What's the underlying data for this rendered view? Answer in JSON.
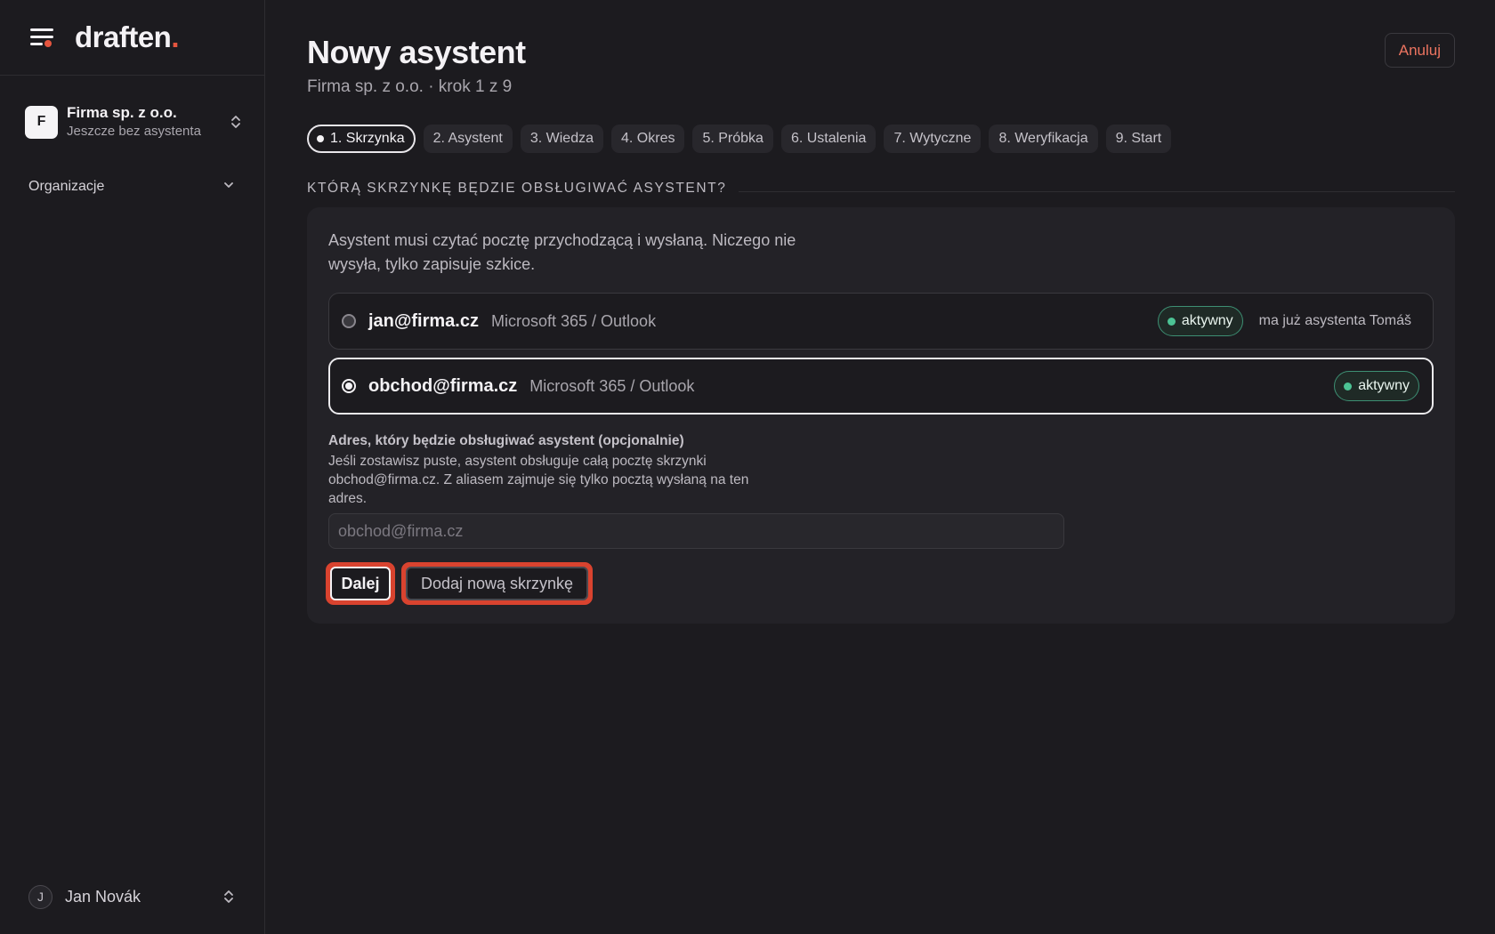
{
  "app": {
    "logo_text": "draften",
    "logo_dot": ".",
    "brand_color": "#e5553f"
  },
  "sidebar": {
    "org": {
      "avatar_letter": "F",
      "name": "Firma sp. z o.o.",
      "subtitle": "Jeszcze bez asystenta"
    },
    "nav": {
      "organizations_label": "Organizacje"
    },
    "user": {
      "avatar_letter": "J",
      "name": "Jan Novák"
    }
  },
  "header": {
    "title": "Nowy asystent",
    "subtitle": "Firma sp. z o.o. · krok 1 z 9",
    "cancel_label": "Anuluj"
  },
  "steps": [
    {
      "label": "1. Skrzynka",
      "active": true
    },
    {
      "label": "2. Asystent",
      "active": false
    },
    {
      "label": "3. Wiedza",
      "active": false
    },
    {
      "label": "4. Okres",
      "active": false
    },
    {
      "label": "5. Próbka",
      "active": false
    },
    {
      "label": "6. Ustalenia",
      "active": false
    },
    {
      "label": "7. Wytyczne",
      "active": false
    },
    {
      "label": "8. Weryfikacja",
      "active": false
    },
    {
      "label": "9. Start",
      "active": false
    }
  ],
  "section": {
    "title": "KTÓRĄ SKRZYNKĘ BĘDZIE OBSŁUGIWAĆ ASYSTENT?",
    "intro": "Asystent musi czytać pocztę przychodzącą i wysłaną. Niczego nie wysyła, tylko zapisuje szkice."
  },
  "mailboxes": [
    {
      "email": "jan@firma.cz",
      "provider": "Microsoft 365 / Outlook",
      "status": "aktywny",
      "note": "ma już asystenta Tomáš",
      "selected": false
    },
    {
      "email": "obchod@firma.cz",
      "provider": "Microsoft 365 / Outlook",
      "status": "aktywny",
      "note": "",
      "selected": true
    }
  ],
  "alias": {
    "label": "Adres, który będzie obsługiwać asystent (opcjonalnie)",
    "help": "Jeśli zostawisz puste, asystent obsługuje całą pocztę skrzynki obchod@firma.cz. Z aliasem zajmuje się tylko pocztą wysłaną na ten adres.",
    "value": "",
    "placeholder": "obchod@firma.cz"
  },
  "actions": {
    "next_label": "Dalej",
    "add_mailbox_label": "Dodaj nową skrzynkę"
  },
  "colors": {
    "status_active": "#4cc394",
    "cancel_text": "#ec7460",
    "focus_ring": "#d9432f"
  }
}
